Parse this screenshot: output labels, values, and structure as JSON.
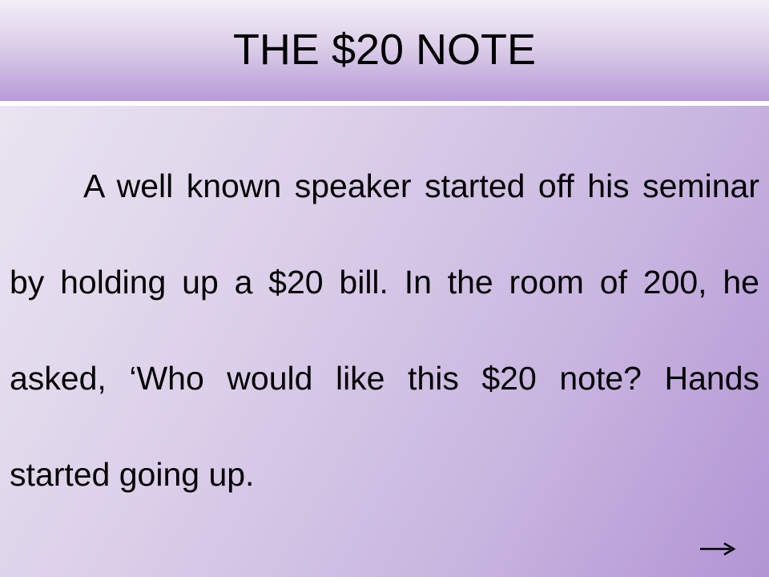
{
  "slide": {
    "title": "THE $20 NOTE",
    "body": "A well known speaker started off his seminar by holding up a $20 bill. In the room of 200, he asked, ‘Who would like this $20 note? Hands started going up.",
    "next_icon": "right-arrow-icon"
  },
  "colors": {
    "text": "#000000",
    "background_light": "#ece8f2",
    "background_accent": "#b294d4",
    "divider": "#ffffff"
  }
}
